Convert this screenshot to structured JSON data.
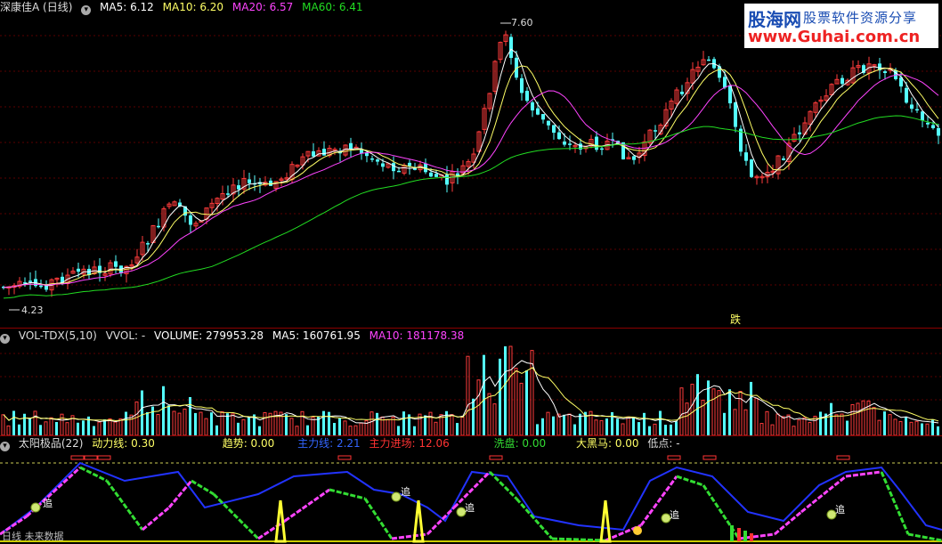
{
  "price_panel": {
    "title": "深康佳A (日线)",
    "ma5": "MA5: 6.12",
    "ma10": "MA10: 6.20",
    "ma20": "MA20: 6.57",
    "ma60": "MA60: 6.41",
    "high_label": "7.60",
    "low_label": "4.23",
    "signal_label": "跌"
  },
  "volume_panel": {
    "title": "VOL-TDX(5,10)",
    "vvol": "VVOL: -",
    "volume": "VOLUME: 279953.28",
    "ma5": "MA5: 160761.95",
    "ma10": "MA10: 181178.38"
  },
  "indicator_panel": {
    "title": "太阳极品(22)",
    "dongli": "动力线: 0.30",
    "qushi": "趋势: 0.00",
    "zhuli": "主力线: 2.21",
    "jinchang": "主力进场: 12.06",
    "xipan": "洗盘: 0.00",
    "daheima": "大黑马: 0.00",
    "didian": "低点: -",
    "zhui_label": "追",
    "footer": "日线 未来数据"
  },
  "watermark": {
    "cn": "股海网",
    "cn2": "股票软件资源分享",
    "url": "www.Guhai.com.cn"
  },
  "colors": {
    "up": "#ff3b3b",
    "down": "#54ffff",
    "ma5": "#ffffff",
    "ma10": "#ffff66",
    "ma20": "#ff44ff",
    "ma60": "#22dd22",
    "main_line": "#2233ff",
    "power_line": "#ff44ff",
    "power_line_alt": "#33dd33",
    "spike": "#ffff33"
  }
}
